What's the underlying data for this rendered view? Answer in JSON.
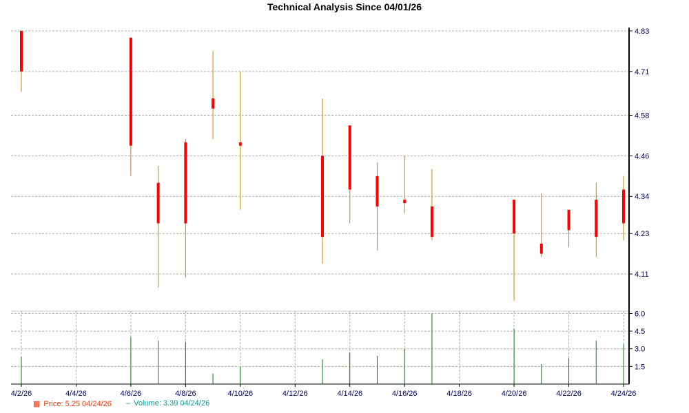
{
  "chart_data": {
    "type": "candlestick",
    "title": "Technical Analysis Since 04/01/26",
    "price_axis": {
      "ylim": [
        4.0,
        4.84
      ],
      "ticks": [
        "4.11",
        "4.23",
        "4.34",
        "4.46",
        "4.58",
        "4.71",
        "4.83"
      ]
    },
    "volume_axis": {
      "ylim": [
        0,
        6.2
      ],
      "ticks": [
        "1.5",
        "3.0",
        "4.5",
        "6.0"
      ]
    },
    "x_axis": {
      "start": "2026-04-02",
      "end": "2026-04-24",
      "tick_labels": [
        "4/2/26",
        "4/4/26",
        "4/6/26",
        "4/8/26",
        "4/10/26",
        "4/12/26",
        "4/14/26",
        "4/16/26",
        "4/18/26",
        "4/20/26",
        "4/22/26",
        "4/24/26"
      ]
    },
    "candles": [
      {
        "date": "2026-04-02",
        "open": 4.71,
        "high": 4.83,
        "low": 4.65,
        "close": 4.83
      },
      {
        "date": "2026-04-06",
        "open": 4.49,
        "high": 4.81,
        "low": 4.4,
        "close": 4.81
      },
      {
        "date": "2026-04-07",
        "open": 4.26,
        "high": 4.43,
        "low": 4.07,
        "close": 4.38
      },
      {
        "date": "2026-04-08",
        "open": 4.26,
        "high": 4.51,
        "low": 4.1,
        "close": 4.5
      },
      {
        "date": "2026-04-09",
        "open": 4.6,
        "high": 4.77,
        "low": 4.51,
        "close": 4.63
      },
      {
        "date": "2026-04-10",
        "open": 4.49,
        "high": 4.71,
        "low": 4.3,
        "close": 4.5
      },
      {
        "date": "2026-04-13",
        "open": 4.22,
        "high": 4.63,
        "low": 4.14,
        "close": 4.46
      },
      {
        "date": "2026-04-14",
        "open": 4.36,
        "high": 4.55,
        "low": 4.26,
        "close": 4.55
      },
      {
        "date": "2026-04-15",
        "open": 4.31,
        "high": 4.44,
        "low": 4.18,
        "close": 4.4
      },
      {
        "date": "2026-04-16",
        "open": 4.32,
        "high": 4.46,
        "low": 4.29,
        "close": 4.33
      },
      {
        "date": "2026-04-17",
        "open": 4.22,
        "high": 4.42,
        "low": 4.21,
        "close": 4.31
      },
      {
        "date": "2026-04-20",
        "open": 4.23,
        "high": 4.33,
        "low": 4.03,
        "close": 4.33
      },
      {
        "date": "2026-04-21",
        "open": 4.17,
        "high": 4.35,
        "low": 4.16,
        "close": 4.2
      },
      {
        "date": "2026-04-22",
        "open": 4.24,
        "high": 4.3,
        "low": 4.19,
        "close": 4.3
      },
      {
        "date": "2026-04-23",
        "open": 4.22,
        "high": 4.38,
        "low": 4.16,
        "close": 4.33
      },
      {
        "date": "2026-04-24",
        "open": 4.26,
        "high": 4.4,
        "low": 4.21,
        "close": 4.36
      }
    ],
    "volume": [
      {
        "date": "2026-04-02",
        "value": 2.3
      },
      {
        "date": "2026-04-06",
        "value": 4.0
      },
      {
        "date": "2026-04-07",
        "value": 3.7
      },
      {
        "date": "2026-04-08",
        "value": 3.6
      },
      {
        "date": "2026-04-09",
        "value": 0.9
      },
      {
        "date": "2026-04-10",
        "value": 1.5
      },
      {
        "date": "2026-04-13",
        "value": 2.1
      },
      {
        "date": "2026-04-14",
        "value": 2.7
      },
      {
        "date": "2026-04-15",
        "value": 2.4
      },
      {
        "date": "2026-04-16",
        "value": 3.0
      },
      {
        "date": "2026-04-17",
        "value": 6.0
      },
      {
        "date": "2026-04-20",
        "value": 4.7
      },
      {
        "date": "2026-04-21",
        "value": 1.7
      },
      {
        "date": "2026-04-22",
        "value": 2.2
      },
      {
        "date": "2026-04-23",
        "value": 3.7
      },
      {
        "date": "2026-04-24",
        "value": 3.39
      }
    ],
    "legend": {
      "price": "Price: 5.25  04/24/26",
      "volume": "Volume: 3.39  04/24/26"
    },
    "grid": true,
    "legend_position": "bottom-left"
  },
  "colors": {
    "up": "#ff0000",
    "down": "#008000",
    "wick": "#cc8400",
    "volume": "#008000",
    "axis": "#000000",
    "grid": "#b0b0b0",
    "tick_text": "#000066",
    "legend_price": "#ff3300",
    "legend_volume": "#009999"
  }
}
